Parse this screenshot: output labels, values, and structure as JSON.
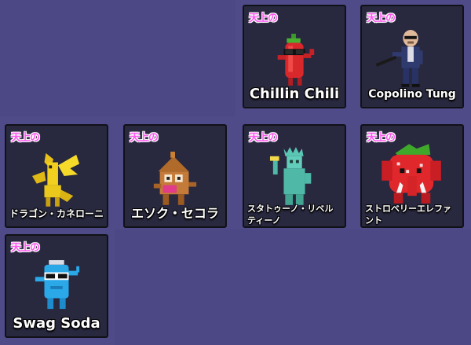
{
  "theme": {
    "background": "#4f4a88",
    "card_background": "#28283f",
    "card_border": "#111118",
    "rarity_color": "#ff55f0",
    "name_color": "#ffffff"
  },
  "cards": [
    {
      "rarity": "天上の",
      "name": "Chillin Chili",
      "icon": "chili-pepper-icon"
    },
    {
      "rarity": "天上の",
      "name": "Copolino Tung",
      "icon": "bald-man-with-bat-icon"
    },
    {
      "rarity": "天上の",
      "name": "ドラゴン・カネローニ",
      "icon": "yellow-dragon-icon"
    },
    {
      "rarity": "天上の",
      "name": "エソク・セコラ",
      "icon": "house-creature-icon"
    },
    {
      "rarity": "天上の",
      "name": "スタトゥーノ・リベルティーノ",
      "icon": "statue-of-liberty-icon"
    },
    {
      "rarity": "天上の",
      "name": "ストロベリーエレファント",
      "icon": "strawberry-elephant-icon"
    },
    {
      "rarity": "天上の",
      "name": "Swag Soda",
      "icon": "soda-can-icon"
    }
  ]
}
